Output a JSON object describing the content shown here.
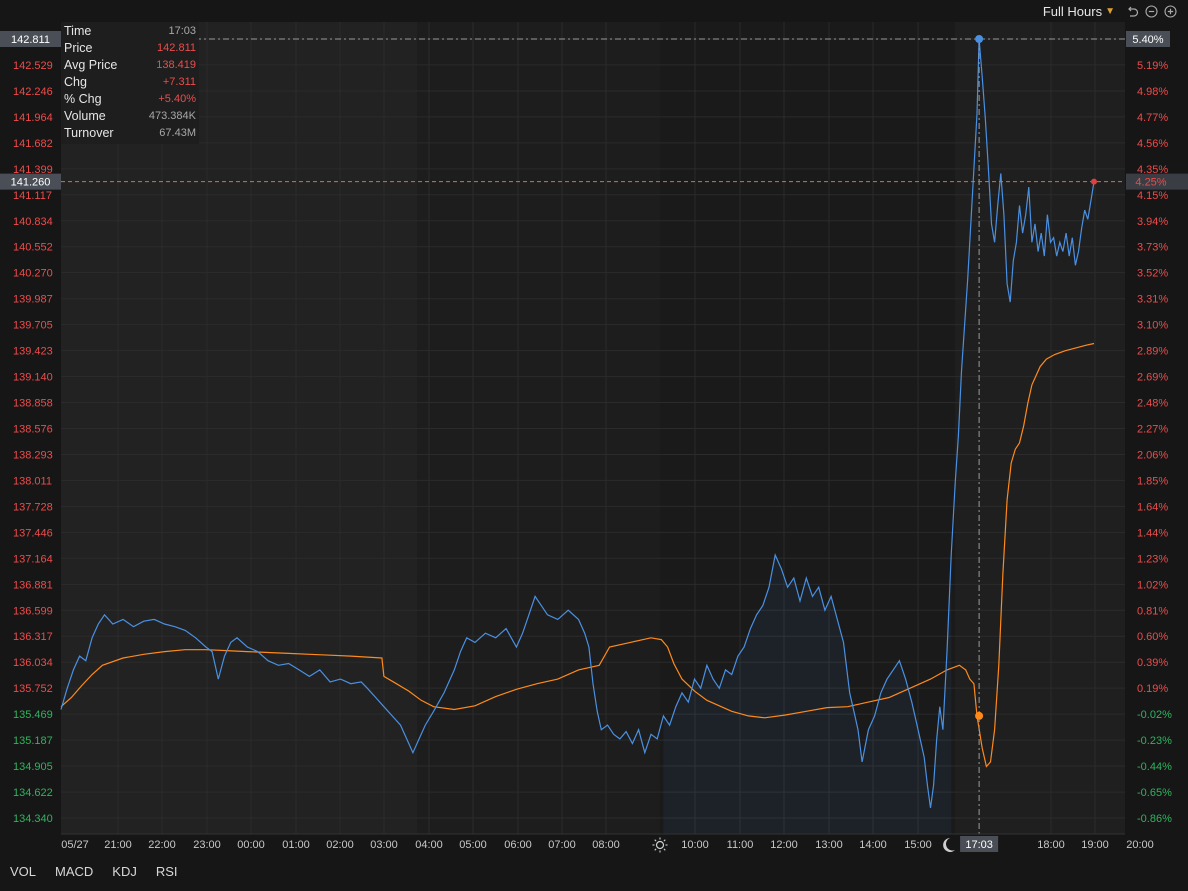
{
  "toolbar": {
    "session_label": "Full Hours"
  },
  "info_panel": {
    "rows": [
      {
        "label": "Time",
        "value": "17:03"
      },
      {
        "label": "Price",
        "value": "142.811"
      },
      {
        "label": "Avg Price",
        "value": "138.419"
      },
      {
        "label": "Chg",
        "value": "+7.311"
      },
      {
        "label": "% Chg",
        "value": "+5.40%"
      },
      {
        "label": "Volume",
        "value": "473.384K"
      },
      {
        "label": "Turnover",
        "value": "67.43M"
      }
    ]
  },
  "indicator_tabs": [
    "VOL",
    "MACD",
    "KDJ",
    "RSI"
  ],
  "colors": {
    "price_line": "#4a90e2",
    "avg_line": "#ff8a1c",
    "up": "#ef4b4b",
    "down": "#2db55d",
    "crosshair_tag_bg": "#4a4f57"
  },
  "chart_data": {
    "type": "line",
    "prev_close": 135.5,
    "x_ticks": [
      "05/27",
      "21:00",
      "22:00",
      "23:00",
      "00:00",
      "01:00",
      "02:00",
      "03:00",
      "04:00",
      "05:00",
      "06:00",
      "07:00",
      "08:00",
      "10:00",
      "11:00",
      "12:00",
      "13:00",
      "14:00",
      "15:00",
      "18:00",
      "19:00",
      "20:00"
    ],
    "y_left_ticks": [
      "142.811",
      "142.529",
      "142.246",
      "141.964",
      "141.682",
      "141.399",
      "141.117",
      "140.834",
      "140.552",
      "140.270",
      "139.987",
      "139.705",
      "139.423",
      "139.140",
      "138.858",
      "138.576",
      "138.293",
      "138.011",
      "137.728",
      "137.446",
      "137.164",
      "136.881",
      "136.599",
      "136.317",
      "136.034",
      "135.752",
      "135.469",
      "135.187",
      "134.905",
      "134.622",
      "134.340"
    ],
    "y_right_ticks": [
      "5.40%",
      "5.19%",
      "4.98%",
      "4.77%",
      "4.56%",
      "4.35%",
      "4.15%",
      "3.94%",
      "3.73%",
      "3.52%",
      "3.31%",
      "3.10%",
      "2.89%",
      "2.69%",
      "2.48%",
      "2.27%",
      "2.06%",
      "1.85%",
      "1.64%",
      "1.44%",
      "1.23%",
      "1.02%",
      "0.81%",
      "0.60%",
      "0.39%",
      "0.19%",
      "-0.02%",
      "-0.23%",
      "-0.44%",
      "-0.65%",
      "-0.86%"
    ],
    "ylim": [
      134.34,
      142.811
    ],
    "crosshair": {
      "time": "17:03",
      "price": "142.811",
      "pct": "5.40%"
    },
    "last": {
      "price": "141.260",
      "pct": "4.25%"
    },
    "series": [
      {
        "name": "Price",
        "points": [
          [
            0,
            135.52
          ],
          [
            0.3,
            135.75
          ],
          [
            0.6,
            135.95
          ],
          [
            0.9,
            136.1
          ],
          [
            1.2,
            136.05
          ],
          [
            1.5,
            136.3
          ],
          [
            1.8,
            136.45
          ],
          [
            2.1,
            136.55
          ],
          [
            2.5,
            136.45
          ],
          [
            3,
            136.5
          ],
          [
            3.5,
            136.42
          ],
          [
            4,
            136.48
          ],
          [
            4.5,
            136.5
          ],
          [
            5,
            136.45
          ],
          [
            5.5,
            136.42
          ],
          [
            6,
            136.38
          ],
          [
            6.5,
            136.3
          ],
          [
            7,
            136.2
          ],
          [
            7.3,
            136.15
          ],
          [
            7.6,
            135.85
          ],
          [
            7.9,
            136.1
          ],
          [
            8.2,
            136.25
          ],
          [
            8.5,
            136.3
          ],
          [
            9,
            136.2
          ],
          [
            9.5,
            136.15
          ],
          [
            10,
            136.05
          ],
          [
            10.5,
            136.0
          ],
          [
            11,
            136.02
          ],
          [
            11.5,
            135.95
          ],
          [
            12,
            135.88
          ],
          [
            12.5,
            135.95
          ],
          [
            13,
            135.82
          ],
          [
            13.5,
            135.85
          ],
          [
            14,
            135.8
          ],
          [
            14.5,
            135.82
          ],
          [
            14.8,
            135.75
          ],
          [
            15.2,
            135.65
          ],
          [
            15.6,
            135.55
          ],
          [
            16,
            135.45
          ],
          [
            16.4,
            135.35
          ],
          [
            16.7,
            135.2
          ],
          [
            17,
            135.05
          ],
          [
            17.3,
            135.2
          ],
          [
            17.6,
            135.35
          ],
          [
            18,
            135.5
          ],
          [
            18.5,
            135.7
          ],
          [
            19,
            135.95
          ],
          [
            19.3,
            136.15
          ],
          [
            19.6,
            136.3
          ],
          [
            20,
            136.25
          ],
          [
            20.5,
            136.35
          ],
          [
            21,
            136.3
          ],
          [
            21.5,
            136.4
          ],
          [
            22,
            136.2
          ],
          [
            22.3,
            136.35
          ],
          [
            22.6,
            136.55
          ],
          [
            22.9,
            136.75
          ],
          [
            23.2,
            136.65
          ],
          [
            23.5,
            136.55
          ],
          [
            24,
            136.5
          ],
          [
            24.5,
            136.6
          ],
          [
            25,
            136.5
          ],
          [
            25.3,
            136.35
          ],
          [
            25.5,
            136.2
          ],
          [
            25.7,
            135.8
          ],
          [
            25.9,
            135.5
          ],
          [
            26.1,
            135.3
          ],
          [
            26.4,
            135.35
          ],
          [
            26.7,
            135.25
          ],
          [
            27,
            135.2
          ],
          [
            27.3,
            135.28
          ],
          [
            27.6,
            135.15
          ],
          [
            27.9,
            135.3
          ],
          [
            28.2,
            135.05
          ],
          [
            28.5,
            135.25
          ],
          [
            28.8,
            135.2
          ],
          [
            29.1,
            135.45
          ],
          [
            29.4,
            135.35
          ],
          [
            29.7,
            135.55
          ],
          [
            30,
            135.7
          ],
          [
            30.3,
            135.6
          ],
          [
            30.6,
            135.85
          ],
          [
            30.9,
            135.75
          ],
          [
            31.2,
            136.0
          ],
          [
            31.5,
            135.85
          ],
          [
            31.8,
            135.75
          ],
          [
            32.1,
            135.95
          ],
          [
            32.4,
            135.9
          ],
          [
            32.7,
            136.1
          ],
          [
            33,
            136.2
          ],
          [
            33.3,
            136.4
          ],
          [
            33.6,
            136.55
          ],
          [
            33.9,
            136.65
          ],
          [
            34.2,
            136.85
          ],
          [
            34.5,
            137.2
          ],
          [
            34.8,
            137.05
          ],
          [
            35.1,
            136.85
          ],
          [
            35.4,
            136.95
          ],
          [
            35.7,
            136.7
          ],
          [
            36,
            136.95
          ],
          [
            36.3,
            136.75
          ],
          [
            36.6,
            136.85
          ],
          [
            36.9,
            136.6
          ],
          [
            37.2,
            136.75
          ],
          [
            37.5,
            136.5
          ],
          [
            37.8,
            136.25
          ],
          [
            38.1,
            135.7
          ],
          [
            38.3,
            135.5
          ],
          [
            38.5,
            135.3
          ],
          [
            38.7,
            134.95
          ],
          [
            39,
            135.3
          ],
          [
            39.3,
            135.45
          ],
          [
            39.6,
            135.7
          ],
          [
            39.9,
            135.85
          ],
          [
            40.2,
            135.95
          ],
          [
            40.5,
            136.05
          ],
          [
            40.8,
            135.85
          ],
          [
            41.1,
            135.6
          ],
          [
            41.3,
            135.4
          ],
          [
            41.5,
            135.2
          ],
          [
            41.7,
            135.0
          ],
          [
            41.85,
            134.7
          ],
          [
            42.0,
            134.45
          ],
          [
            42.15,
            134.7
          ],
          [
            42.3,
            135.2
          ],
          [
            42.45,
            135.55
          ],
          [
            42.6,
            135.3
          ],
          [
            42.8,
            136.15
          ],
          [
            43,
            137.2
          ],
          [
            43.2,
            138.0
          ],
          [
            43.35,
            138.5
          ],
          [
            43.5,
            139.2
          ],
          [
            43.65,
            139.7
          ],
          [
            43.8,
            140.2
          ],
          [
            43.95,
            140.8
          ],
          [
            44.1,
            141.4
          ],
          [
            44.25,
            142.0
          ],
          [
            44.35,
            142.811
          ],
          [
            44.5,
            142.4
          ],
          [
            44.65,
            141.95
          ],
          [
            44.8,
            141.4
          ],
          [
            44.95,
            140.8
          ],
          [
            45.1,
            140.6
          ],
          [
            45.25,
            141.0
          ],
          [
            45.4,
            141.35
          ],
          [
            45.55,
            140.9
          ],
          [
            45.7,
            140.15
          ],
          [
            45.85,
            139.95
          ],
          [
            46.0,
            140.4
          ],
          [
            46.15,
            140.6
          ],
          [
            46.3,
            141.0
          ],
          [
            46.45,
            140.7
          ],
          [
            46.6,
            140.9
          ],
          [
            46.75,
            141.2
          ],
          [
            46.9,
            140.6
          ],
          [
            47.05,
            140.8
          ],
          [
            47.2,
            140.5
          ],
          [
            47.35,
            140.7
          ],
          [
            47.5,
            140.45
          ],
          [
            47.65,
            140.9
          ],
          [
            47.8,
            140.6
          ],
          [
            47.95,
            140.65
          ],
          [
            48.1,
            140.45
          ],
          [
            48.25,
            140.6
          ],
          [
            48.4,
            140.5
          ],
          [
            48.55,
            140.7
          ],
          [
            48.7,
            140.45
          ],
          [
            48.85,
            140.65
          ],
          [
            49.0,
            140.35
          ],
          [
            49.15,
            140.5
          ],
          [
            49.3,
            140.75
          ],
          [
            49.45,
            140.95
          ],
          [
            49.6,
            140.85
          ],
          [
            49.75,
            141.05
          ],
          [
            49.9,
            141.26
          ]
        ]
      },
      {
        "name": "Avg Price",
        "points": [
          [
            0,
            135.55
          ],
          [
            0.5,
            135.65
          ],
          [
            1,
            135.78
          ],
          [
            1.5,
            135.9
          ],
          [
            2,
            136.0
          ],
          [
            3,
            136.08
          ],
          [
            4,
            136.12
          ],
          [
            5,
            136.15
          ],
          [
            6,
            136.17
          ],
          [
            7,
            136.17
          ],
          [
            8,
            136.16
          ],
          [
            9,
            136.15
          ],
          [
            10,
            136.14
          ],
          [
            11,
            136.13
          ],
          [
            12,
            136.12
          ],
          [
            13,
            136.11
          ],
          [
            14,
            136.1
          ],
          [
            15.5,
            136.08
          ],
          [
            15.6,
            135.88
          ],
          [
            16.2,
            135.8
          ],
          [
            16.8,
            135.72
          ],
          [
            17.4,
            135.62
          ],
          [
            18,
            135.55
          ],
          [
            19,
            135.52
          ],
          [
            20,
            135.56
          ],
          [
            21,
            135.66
          ],
          [
            22,
            135.74
          ],
          [
            23,
            135.8
          ],
          [
            24,
            135.85
          ],
          [
            25,
            135.95
          ],
          [
            26,
            136.0
          ],
          [
            26.5,
            136.2
          ],
          [
            27.5,
            136.25
          ],
          [
            28.5,
            136.3
          ],
          [
            29,
            136.28
          ],
          [
            29.3,
            136.2
          ],
          [
            29.6,
            136.02
          ],
          [
            30,
            135.85
          ],
          [
            30.6,
            135.72
          ],
          [
            31.2,
            135.62
          ],
          [
            31.8,
            135.56
          ],
          [
            32.4,
            135.5
          ],
          [
            33.2,
            135.45
          ],
          [
            34,
            135.43
          ],
          [
            35,
            135.46
          ],
          [
            36,
            135.5
          ],
          [
            37,
            135.54
          ],
          [
            38,
            135.55
          ],
          [
            39,
            135.6
          ],
          [
            40,
            135.65
          ],
          [
            41,
            135.75
          ],
          [
            42,
            135.85
          ],
          [
            42.8,
            135.95
          ],
          [
            43.4,
            136.0
          ],
          [
            43.7,
            135.95
          ],
          [
            43.9,
            135.85
          ],
          [
            44.1,
            135.8
          ],
          [
            44.25,
            135.45
          ],
          [
            44.5,
            135.1
          ],
          [
            44.7,
            134.9
          ],
          [
            44.9,
            134.95
          ],
          [
            45.1,
            135.3
          ],
          [
            45.3,
            136.0
          ],
          [
            45.5,
            137.0
          ],
          [
            45.7,
            137.8
          ],
          [
            45.9,
            138.2
          ],
          [
            46.1,
            138.35
          ],
          [
            46.3,
            138.419
          ],
          [
            46.5,
            138.6
          ],
          [
            46.7,
            138.85
          ],
          [
            46.9,
            139.05
          ],
          [
            47.1,
            139.15
          ],
          [
            47.3,
            139.25
          ],
          [
            47.6,
            139.33
          ],
          [
            48.0,
            139.38
          ],
          [
            48.5,
            139.42
          ],
          [
            49.0,
            139.45
          ],
          [
            49.5,
            139.48
          ],
          [
            49.9,
            139.5
          ]
        ]
      }
    ]
  }
}
